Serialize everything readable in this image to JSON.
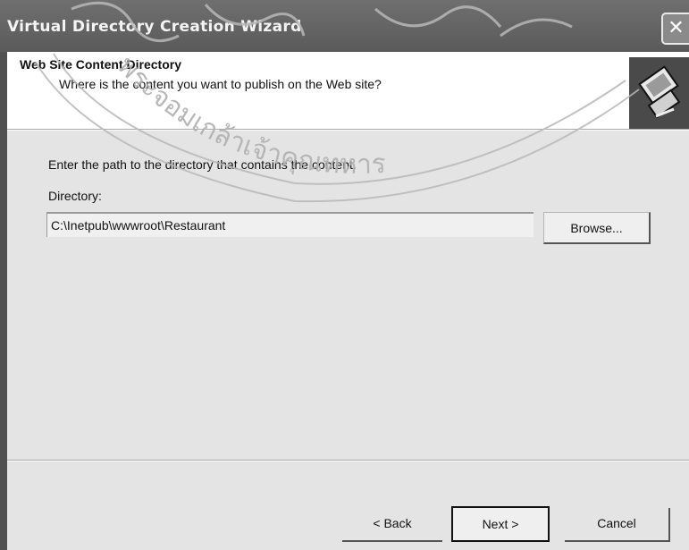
{
  "window": {
    "title": "Virtual Directory Creation Wizard",
    "close_glyph": "✕"
  },
  "header": {
    "title": "Web Site Content Directory",
    "subtitle": "Where is the content you want to publish on the Web site?",
    "icon": "wizard-computer-icon"
  },
  "body": {
    "instruction": "Enter the path to the directory that contains the content.",
    "directory_label": "Directory:",
    "directory_value": "C:\\Inetpub\\wwwroot\\Restaurant",
    "browse_label": "Browse..."
  },
  "footer": {
    "back_label": "< Back",
    "next_label": "Next >",
    "cancel_label": "Cancel"
  },
  "watermark": {
    "text": "พระจอมเกล้าเจ้าคุณทหาร"
  },
  "colors": {
    "titlebar": "#5f5f5f",
    "header_bg": "#ffffff",
    "content_bg": "#e4e4e4"
  }
}
